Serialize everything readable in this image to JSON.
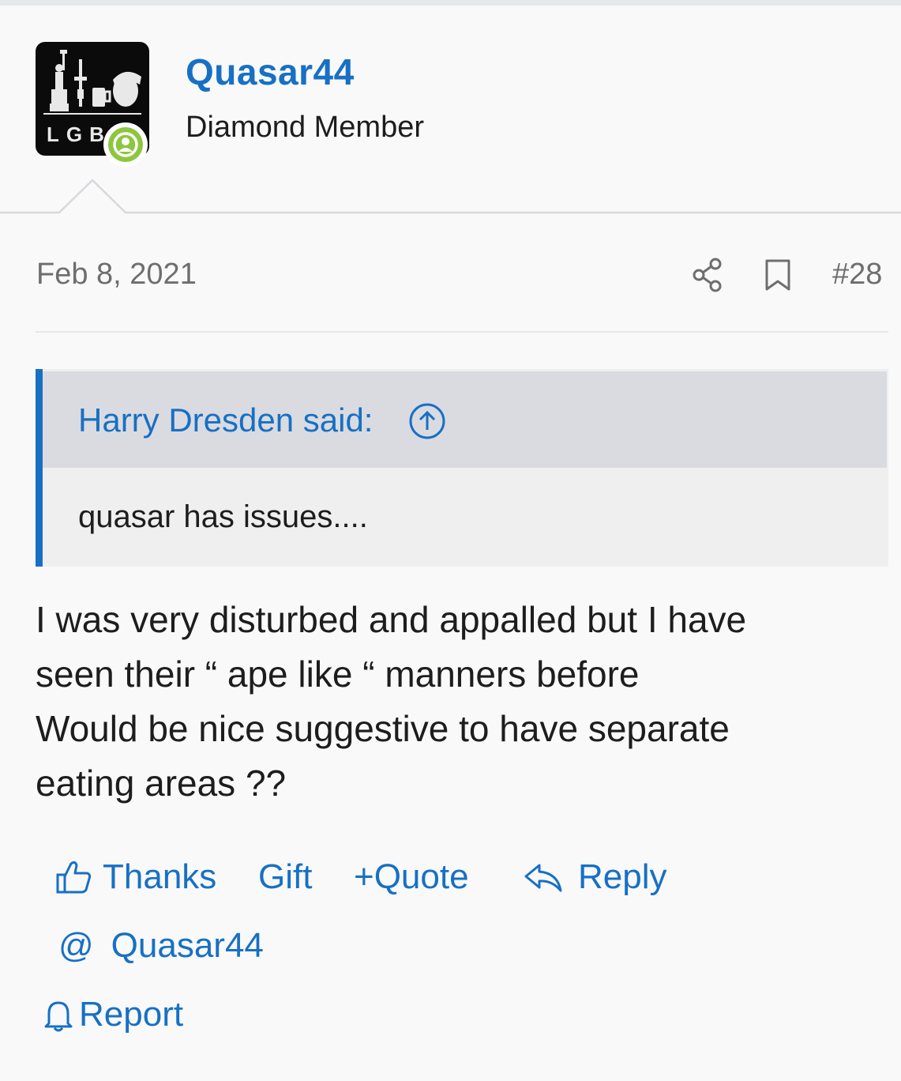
{
  "user": {
    "name": "Quasar44",
    "title": "Diamond Member",
    "avatar_text": "LGB",
    "online": true
  },
  "post": {
    "date": "Feb 8, 2021",
    "number": "#28",
    "quote": {
      "author_line": "Harry Dresden said:",
      "text": "quasar has issues...."
    },
    "body_lines": [
      "I was very disturbed and appalled but I have",
      "seen their “ ape like “ manners before",
      "Would be nice suggestive to have separate",
      "eating areas ??"
    ]
  },
  "actions": {
    "thanks": "Thanks",
    "gift": "Gift",
    "quote_plus": "+",
    "quote": "Quote",
    "reply": "Reply",
    "mention_at": "@",
    "mention_name": "Quasar44",
    "report": "Report"
  },
  "colors": {
    "link": "#1770c4",
    "online": "#8dc63f",
    "background": "#f9f9fa",
    "quote_header": "#dadbe0",
    "quote_body": "#efeff0"
  },
  "icons": {
    "share": "share-icon",
    "bookmark": "bookmark-icon",
    "quote_jump": "arrow-up-circle-icon",
    "thanks": "thumbs-up-icon",
    "reply": "reply-arrow-icon",
    "report": "bell-icon",
    "online": "user-online-icon"
  }
}
